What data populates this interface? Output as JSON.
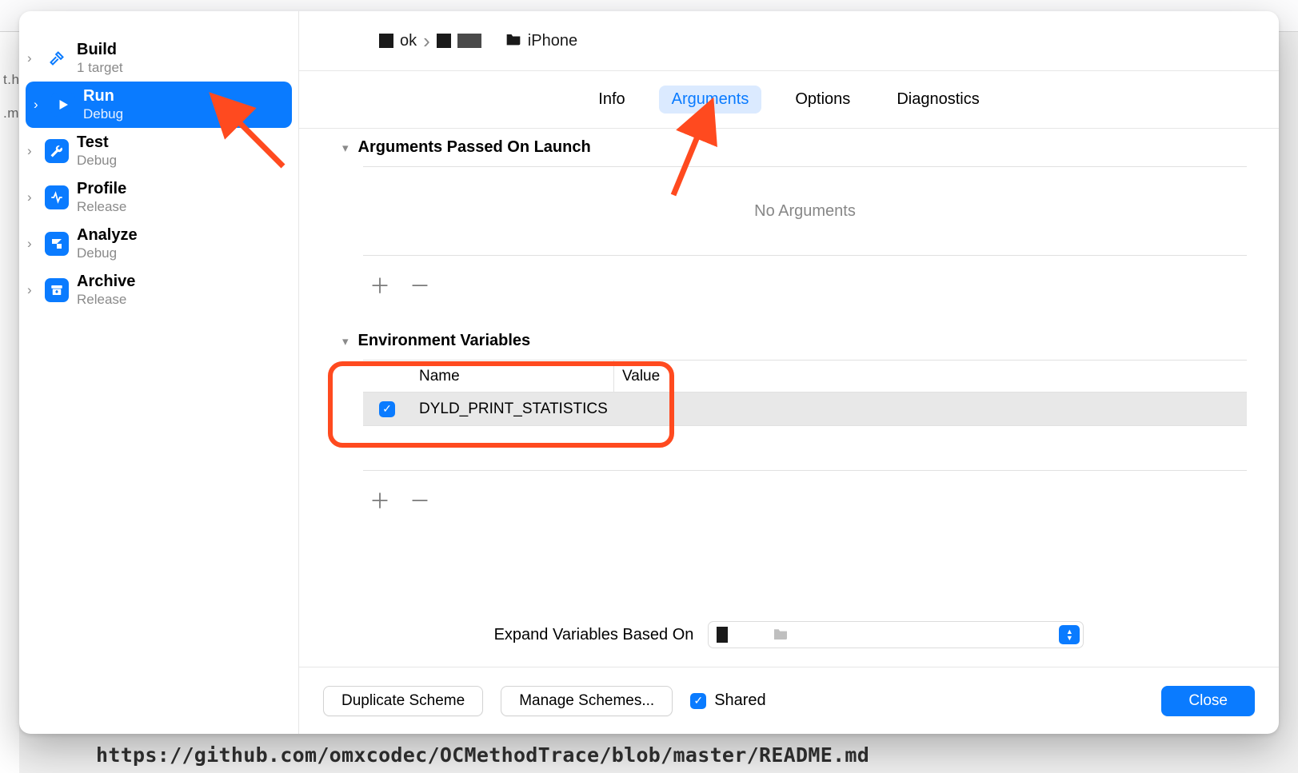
{
  "sidebar": [
    {
      "title": "Build",
      "sub": "1 target"
    },
    {
      "title": "Run",
      "sub": "Debug"
    },
    {
      "title": "Test",
      "sub": "Debug"
    },
    {
      "title": "Profile",
      "sub": "Release"
    },
    {
      "title": "Analyze",
      "sub": "Debug"
    },
    {
      "title": "Archive",
      "sub": "Release"
    }
  ],
  "breadcrumb": {
    "a": "ok",
    "b": "iPhone"
  },
  "tabs": {
    "info": "Info",
    "arguments": "Arguments",
    "options": "Options",
    "diagnostics": "Diagnostics"
  },
  "args_section": {
    "title": "Arguments Passed On Launch",
    "empty": "No Arguments"
  },
  "env_section": {
    "title": "Environment Variables",
    "col_name": "Name",
    "col_value": "Value",
    "rows": [
      {
        "checked": true,
        "name": "DYLD_PRINT_STATISTICS",
        "value": ""
      }
    ]
  },
  "expand": {
    "label": "Expand Variables Based On"
  },
  "footer": {
    "duplicate": "Duplicate Scheme",
    "manage": "Manage Schemes...",
    "shared": "Shared",
    "close": "Close"
  },
  "backdrop": {
    "h": "t.h",
    "m": ".m"
  },
  "url": "https://github.com/omxcodec/OCMethodTrace/blob/master/README.md"
}
